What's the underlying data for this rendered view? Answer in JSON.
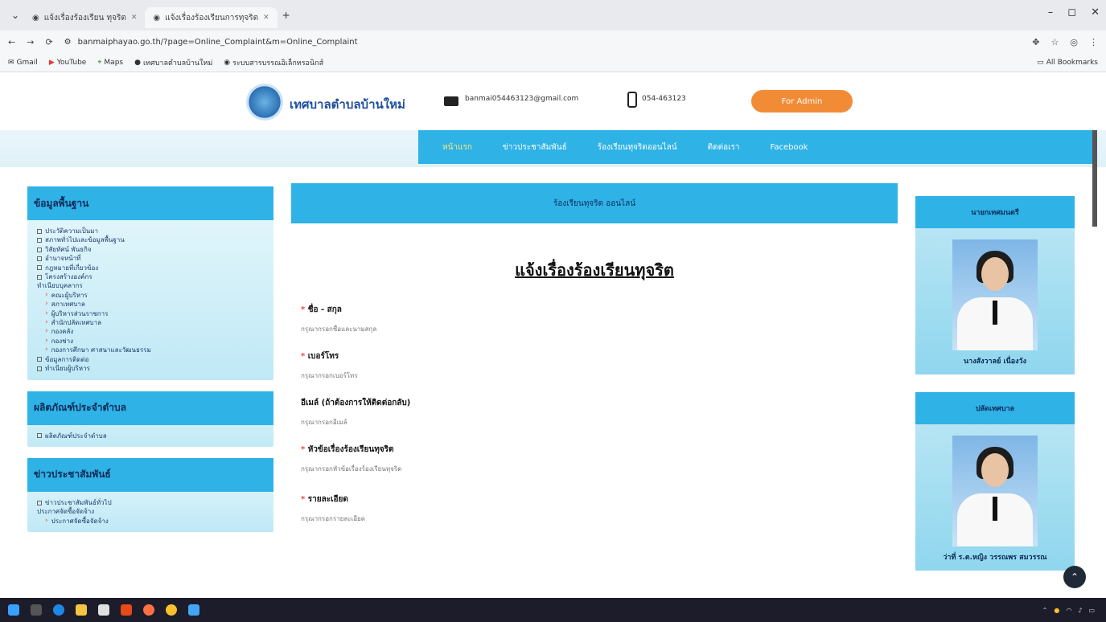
{
  "browser": {
    "tabs": [
      {
        "title": "แจ้งเรื่องร้องเรียน ทุจริต",
        "active": false
      },
      {
        "title": "แจ้งเรื่องร้องเรียนการทุจริต",
        "active": true
      }
    ],
    "new_tab": "+",
    "url": "banmaiphayao.go.th/?page=Online_Complaint&m=Online_Complaint",
    "bookmarks": [
      "Gmail",
      "YouTube",
      "Maps",
      "เทศบาลตำบลบ้านใหม่",
      "ระบบสารบรรณอิเล็กทรอนิกส์"
    ],
    "all_bookmarks": "All Bookmarks"
  },
  "header": {
    "site_name": "เทศบาลตำบลบ้านใหม่",
    "email": "banmai054463123@gmail.com",
    "phone": "054-463123",
    "admin_button": "For Admin"
  },
  "nav": {
    "items": [
      {
        "label": "หน้าแรก",
        "active": true
      },
      {
        "label": "ข่าวประชาสัมพันธ์",
        "active": false
      },
      {
        "label": "ร้องเรียนทุจริตออนไลน์",
        "active": false
      },
      {
        "label": "ติดต่อเรา",
        "active": false
      },
      {
        "label": "Facebook",
        "active": false
      }
    ]
  },
  "left": {
    "panels": [
      {
        "title": "ข้อมูลพื้นฐาน",
        "items": [
          {
            "label": "ประวัติความเป็นมา",
            "sub": false
          },
          {
            "label": "สภาพทั่วไปและข้อมูลพื้นฐาน",
            "sub": false
          },
          {
            "label": "วิสัยทัศน์ พันธกิจ",
            "sub": false
          },
          {
            "label": "อำนาจหน้าที่",
            "sub": false
          },
          {
            "label": "กฎหมายที่เกี่ยวข้อง",
            "sub": false
          },
          {
            "label": "โครงสร้างองค์กร",
            "sub": false
          },
          {
            "label": "ทำเนียบบุคลากร",
            "sub": false
          },
          {
            "label": "คณะผู้บริหาร",
            "sub": true
          },
          {
            "label": "สภาเทศบาล",
            "sub": true
          },
          {
            "label": "ผู้บริหารส่วนราชการ",
            "sub": true
          },
          {
            "label": "สำนักปลัดเทศบาล",
            "sub": true
          },
          {
            "label": "กองคลัง",
            "sub": true
          },
          {
            "label": "กองช่าง",
            "sub": true
          },
          {
            "label": "กองการศึกษา ศาสนาและวัฒนธรรม",
            "sub": true
          },
          {
            "label": "ข้อมูลการติดต่อ",
            "sub": false
          },
          {
            "label": "ทำเนียบผู้บริหาร",
            "sub": false
          }
        ]
      },
      {
        "title": "ผลิตภัณฑ์ประจำตำบล",
        "items": [
          {
            "label": "ผลิตภัณฑ์ประจำตำบล",
            "sub": false
          }
        ]
      },
      {
        "title": "ข่าวประชาสัมพันธ์",
        "items": [
          {
            "label": "ข่าวประชาสัมพันธ์ทั่วไป",
            "sub": false
          },
          {
            "label": "ประกาศจัดซื้อจัดจ้าง",
            "sub": false
          },
          {
            "label": "ประกาศจัดซื้อจัดจ้าง",
            "sub": true
          }
        ]
      }
    ]
  },
  "main": {
    "header": "ร้องเรียนทุจริต ออนไลน์",
    "title": "แจ้งเรื่องร้องเรียนทุจริต",
    "fields": [
      {
        "label": "ชื่อ - สกุล",
        "required": true,
        "placeholder": "กรุณากรอกชื่อและนามสกุล"
      },
      {
        "label": "เบอร์โทร",
        "required": true,
        "placeholder": "กรุณากรอกเบอร์โทร"
      },
      {
        "label": "อีเมล์ (ถ้าต้องการให้ติดต่อกลับ)",
        "required": false,
        "placeholder": "กรุณากรอกอีเมล์"
      },
      {
        "label": "หัวข้อเรื่องร้องเรียนทุจริต",
        "required": true,
        "placeholder": "กรุณากรอกหัวข้อเรื่องร้องเรียนทุจริต"
      },
      {
        "label": "รายละเอียด",
        "required": true,
        "placeholder": "กรุณากรอกรายละเอียด"
      }
    ]
  },
  "right": {
    "panels": [
      {
        "title": "นายกเทศมนตรี",
        "name": "นางสังวาลย์ เนื่องวัง"
      },
      {
        "title": "ปลัดเทศบาล",
        "name": "ว่าที่ ร.ต.หญิง วรรณพร สมวรรณ"
      }
    ]
  },
  "colors": {
    "accent": "#2fb2e6",
    "admin_button": "#f28b36"
  }
}
